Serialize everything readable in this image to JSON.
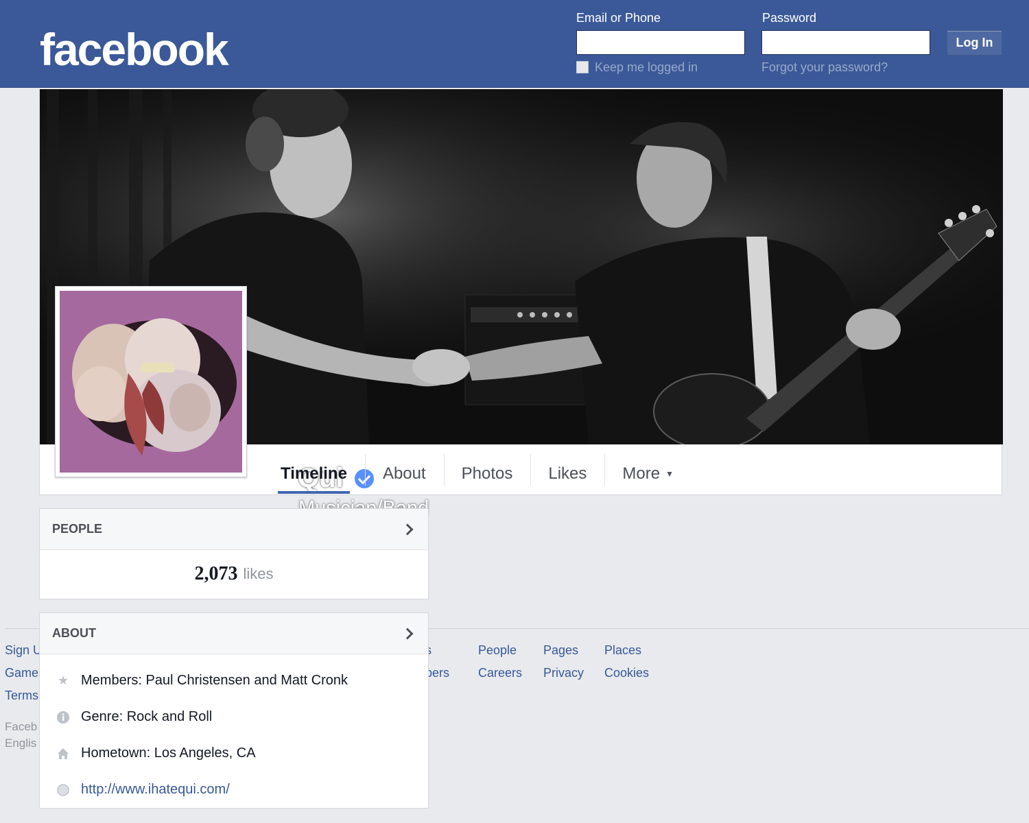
{
  "header": {
    "logo": "facebook",
    "email_label": "Email or Phone",
    "email_value": "",
    "password_label": "Password",
    "password_value": "",
    "keep_logged_in": "Keep me logged in",
    "forgot_password": "Forgot your password?",
    "login_button": "Log In"
  },
  "page": {
    "name": "Qui",
    "category": "Musician/Band",
    "verified": true
  },
  "tabs": [
    {
      "label": "Timeline",
      "active": true
    },
    {
      "label": "About"
    },
    {
      "label": "Photos"
    },
    {
      "label": "Likes"
    },
    {
      "label": "More"
    }
  ],
  "people_box": {
    "title": "PEOPLE",
    "likes_count": "2,073",
    "likes_word": "likes"
  },
  "about_box": {
    "title": "ABOUT",
    "items": [
      {
        "icon": "star-icon",
        "text": "Members: Paul Christensen and Matt Cronk"
      },
      {
        "icon": "info-icon",
        "text": "Genre: Rock and Roll"
      },
      {
        "icon": "home-icon",
        "text": "Hometown: Los Angeles, CA"
      },
      {
        "icon": "globe-icon",
        "text": "http://www.ihatequi.com/"
      }
    ]
  },
  "footer": {
    "col1": [
      "Sign U",
      "Games",
      "Terms"
    ],
    "col2": [
      "s",
      "pers"
    ],
    "col3": [
      "People",
      "Careers"
    ],
    "col4": [
      "Pages",
      "Privacy"
    ],
    "col5": [
      "Places",
      "Cookies"
    ],
    "bottom": [
      "Faceb",
      "Englis"
    ]
  },
  "colors": {
    "brand_blue": "#3b5998",
    "link": "#365899",
    "background": "#e9eaed"
  }
}
